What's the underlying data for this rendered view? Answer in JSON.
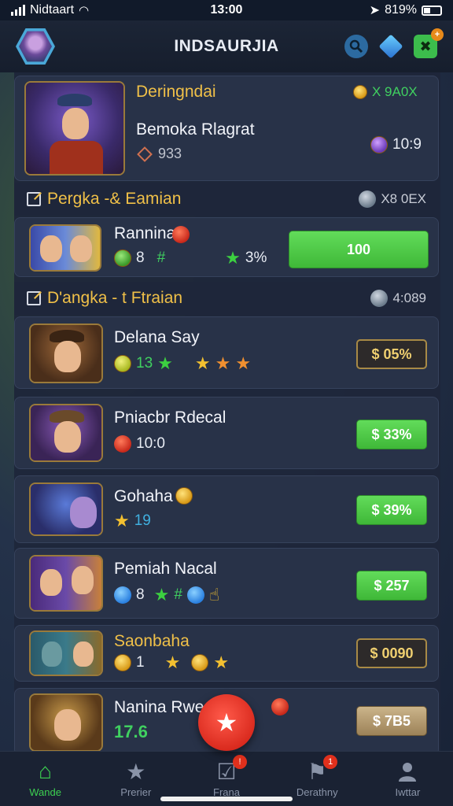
{
  "status_bar": {
    "carrier": "Nidtaart",
    "time": "13:00",
    "battery": "819%"
  },
  "app_bar": {
    "title": "INDSAURJIA",
    "notification_badge": "+"
  },
  "featured": {
    "title": "Deringndai",
    "right_text": "X 9A0X",
    "subtitle": "Bemoka Rlagrat",
    "stat_left": "933",
    "stat_right": "10:9"
  },
  "section1": {
    "label": "Pergka -& Eamian",
    "right_text": "X8 0EX"
  },
  "card1": {
    "title": "Rannina",
    "stat_a": "8",
    "stat_b": "#",
    "stat_c": "3%",
    "button": "100"
  },
  "section2": {
    "label": "D'angka - t Ftraian",
    "right_text": "4:089"
  },
  "items": [
    {
      "title": "Delana Say",
      "stat": "13",
      "button": "$ 05%"
    },
    {
      "title": "Pniacbr Rdecal",
      "stat": "10:0",
      "button": "$ 33%"
    },
    {
      "title": "Gohaha",
      "stat": "19",
      "button": "$ 39%"
    },
    {
      "title": "Pemiah Nacal",
      "stat_a": "8",
      "stat_b": "#",
      "button": "$ 257"
    },
    {
      "title": "Saonbaha",
      "stat": "1",
      "button": "$ 0090"
    },
    {
      "title": "Nanina Rwee",
      "stat": "17.6",
      "button": "$ 7B5"
    }
  ],
  "tabs": [
    {
      "label": "Wande",
      "icon": "home-icon",
      "active": true
    },
    {
      "label": "Prerier",
      "icon": "star-icon"
    },
    {
      "label": "Frana",
      "icon": "check-box-icon",
      "badge": "!"
    },
    {
      "label": "Derathny",
      "icon": "flag-icon",
      "badge": "1"
    },
    {
      "label": "Iwttar",
      "icon": "user-icon"
    }
  ],
  "colors": {
    "accent_green": "#3cd050",
    "gold": "#f0c048",
    "panel": "#283248"
  }
}
